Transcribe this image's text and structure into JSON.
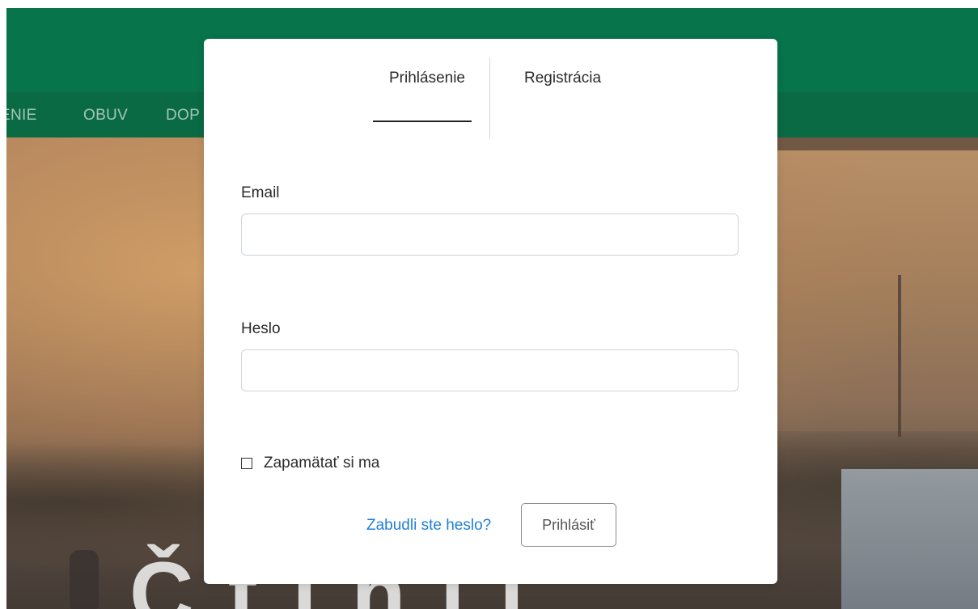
{
  "background": {
    "header_color": "#07744b",
    "nav_color": "#0a6a44",
    "nav_items": [
      "ENIE",
      "OBUV",
      "DOP"
    ],
    "hero_text": "Č t  l  h l i"
  },
  "modal": {
    "tabs": [
      {
        "label": "Prihlásenie",
        "active": true
      },
      {
        "label": "Registrácia",
        "active": false
      }
    ],
    "email": {
      "label": "Email",
      "value": "",
      "placeholder": ""
    },
    "password": {
      "label": "Heslo",
      "value": "",
      "placeholder": ""
    },
    "remember_me": {
      "label": "Zapamätať si ma",
      "checked": false
    },
    "forgot_password_link": "Zabudli ste heslo?",
    "submit_button": "Prihlásiť",
    "link_color": "#1e7fd6"
  }
}
